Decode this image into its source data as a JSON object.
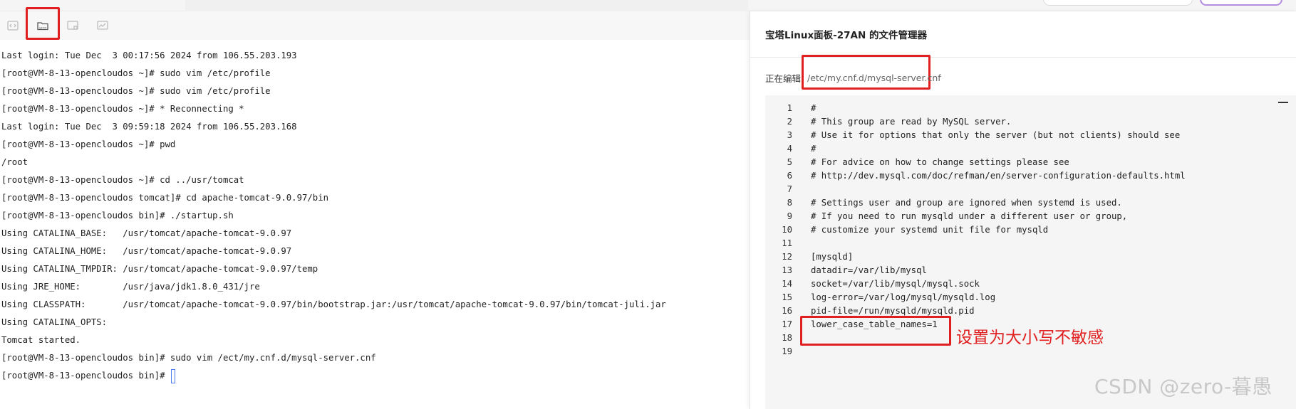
{
  "toolbar": {
    "icons": [
      "code-icon",
      "sftp-folder-icon",
      "file-monitor-icon",
      "chart-monitor-icon"
    ],
    "sftp_label": "SFTP"
  },
  "terminal": {
    "lines": [
      "Last login: Tue Dec  3 00:17:56 2024 from 106.55.203.193",
      "[root@VM-8-13-opencloudos ~]# sudo vim /etc/profile",
      "[root@VM-8-13-opencloudos ~]# sudo vim /etc/profile",
      "[root@VM-8-13-opencloudos ~]# * Reconnecting *",
      "Last login: Tue Dec  3 09:59:18 2024 from 106.55.203.168",
      "[root@VM-8-13-opencloudos ~]# pwd",
      "/root",
      "[root@VM-8-13-opencloudos ~]# cd ../usr/tomcat",
      "[root@VM-8-13-opencloudos tomcat]# cd apache-tomcat-9.0.97/bin",
      "[root@VM-8-13-opencloudos bin]# ./startup.sh",
      "Using CATALINA_BASE:   /usr/tomcat/apache-tomcat-9.0.97",
      "Using CATALINA_HOME:   /usr/tomcat/apache-tomcat-9.0.97",
      "Using CATALINA_TMPDIR: /usr/tomcat/apache-tomcat-9.0.97/temp",
      "Using JRE_HOME:        /usr/java/jdk1.8.0_431/jre",
      "Using CLASSPATH:       /usr/tomcat/apache-tomcat-9.0.97/bin/bootstrap.jar:/usr/tomcat/apache-tomcat-9.0.97/bin/tomcat-juli.jar",
      "Using CATALINA_OPTS:",
      "Tomcat started.",
      "[root@VM-8-13-opencloudos bin]# sudo vim /ect/my.cnf.d/mysql-server.cnf"
    ],
    "prompt": "[root@VM-8-13-opencloudos bin]# "
  },
  "panel": {
    "title": "宝塔Linux面板-27AN 的文件管理器",
    "editing_label": "正在编辑",
    "file_path": "/etc/my.cnf.d/mysql-server.cnf"
  },
  "editor": {
    "lines": [
      {
        "n": "1",
        "text": "#"
      },
      {
        "n": "2",
        "text": "# This group are read by MySQL server."
      },
      {
        "n": "3",
        "text": "# Use it for options that only the server (but not clients) should see"
      },
      {
        "n": "4",
        "text": "#"
      },
      {
        "n": "5",
        "text": "# For advice on how to change settings please see"
      },
      {
        "n": "6",
        "text": "# http://dev.mysql.com/doc/refman/en/server-configuration-defaults.html"
      },
      {
        "n": "7",
        "text": ""
      },
      {
        "n": "8",
        "text": "# Settings user and group are ignored when systemd is used."
      },
      {
        "n": "9",
        "text": "# If you need to run mysqld under a different user or group,"
      },
      {
        "n": "10",
        "text": "# customize your systemd unit file for mysqld"
      },
      {
        "n": "11",
        "text": ""
      },
      {
        "n": "12",
        "text": "[mysqld]"
      },
      {
        "n": "13",
        "text": "datadir=/var/lib/mysql"
      },
      {
        "n": "14",
        "text": "socket=/var/lib/mysql/mysql.sock"
      },
      {
        "n": "15",
        "text": "log-error=/var/log/mysql/mysqld.log"
      },
      {
        "n": "16",
        "text": "pid-file=/run/mysqld/mysqld.pid"
      },
      {
        "n": "17",
        "text": "lower_case_table_names=1"
      },
      {
        "n": "18",
        "text": ""
      },
      {
        "n": "19",
        "text": ""
      }
    ]
  },
  "annotation": {
    "note": "设置为大小写不敏感",
    "color": "#e02020"
  },
  "watermark": "CSDN @zero-暮愚"
}
